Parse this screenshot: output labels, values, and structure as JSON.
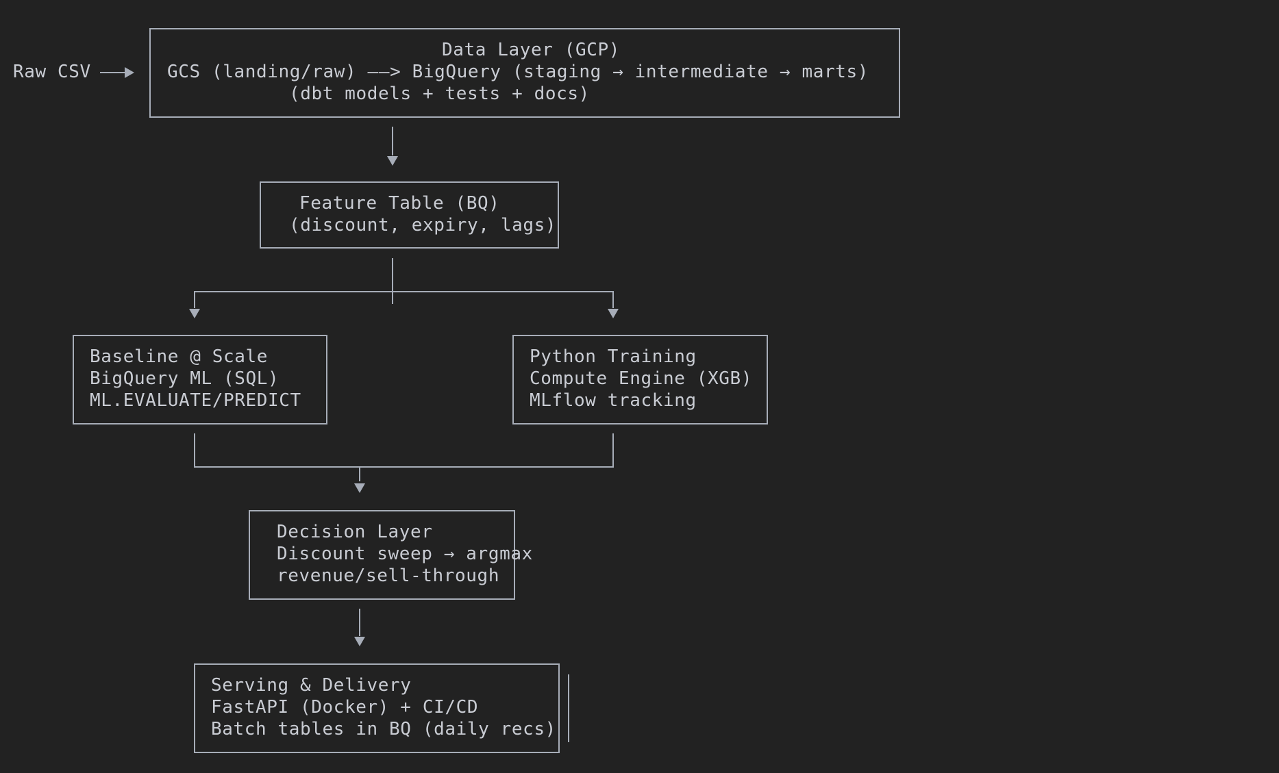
{
  "input": {
    "label": "Raw CSV"
  },
  "data_layer": {
    "title": "Data Layer (GCP)",
    "line1": "GCS (landing/raw) ——> BigQuery (staging → intermediate → marts)",
    "line2": "(dbt models + tests + docs)"
  },
  "feature_table": {
    "line1": "Feature Table (BQ)",
    "line2": "(discount, expiry, lags)"
  },
  "baseline": {
    "line1": "Baseline @ Scale",
    "line2": "BigQuery ML (SQL)",
    "line3": "ML.EVALUATE/PREDICT"
  },
  "python_training": {
    "line1": "Python Training",
    "line2": "Compute Engine (XGB)",
    "line3": "MLflow tracking"
  },
  "decision_layer": {
    "line1": "Decision Layer",
    "line2": "Discount sweep → argmax",
    "line3": "revenue/sell-through"
  },
  "serving": {
    "line1": "Serving & Delivery",
    "line2": "FastAPI (Docker) + CI/CD",
    "line3": "Batch tables in BQ (daily recs)"
  },
  "colors": {
    "background": "#222222",
    "text": "#c9ccd3",
    "line": "#a7adb8"
  }
}
